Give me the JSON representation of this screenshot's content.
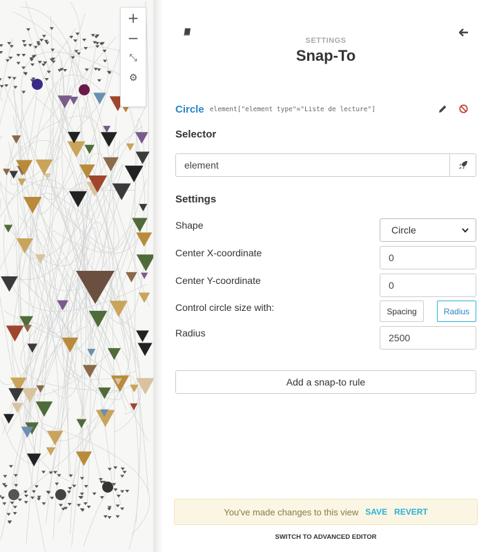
{
  "graph": {
    "zoom_in": "+",
    "zoom_out": "−",
    "fit": "⤡",
    "filter": "⚙"
  },
  "panel": {
    "eyebrow": "SETTINGS",
    "title": "Snap-To",
    "rule": {
      "type": "Circle",
      "selector": "element[\"element type\"=\"Liste de lecture\"]"
    },
    "selector_section": {
      "label": "Selector",
      "value": "element"
    },
    "settings_section": {
      "label": "Settings",
      "shape_label": "Shape",
      "shape_value": "Circle",
      "center_x_label": "Center X-coordinate",
      "center_x_value": "0",
      "center_y_label": "Center Y-coordinate",
      "center_y_value": "0",
      "size_label": "Control circle size with:",
      "size_options": [
        "Spacing",
        "Radius"
      ],
      "size_selected": "Radius",
      "radius_label": "Radius",
      "radius_value": "2500"
    },
    "add_rule_label": "Add a snap-to rule",
    "changes": {
      "message": "You've made changes to this view",
      "save": "SAVE",
      "revert": "REVERT"
    },
    "advanced_editor": "SWITCH TO ADVANCED EDITOR"
  },
  "colors": {
    "accent_blue": "#2a85c7",
    "toggle_active": "#2bb0d9",
    "delete_red": "#c0392b",
    "notice_bg": "#fbf6e3"
  }
}
